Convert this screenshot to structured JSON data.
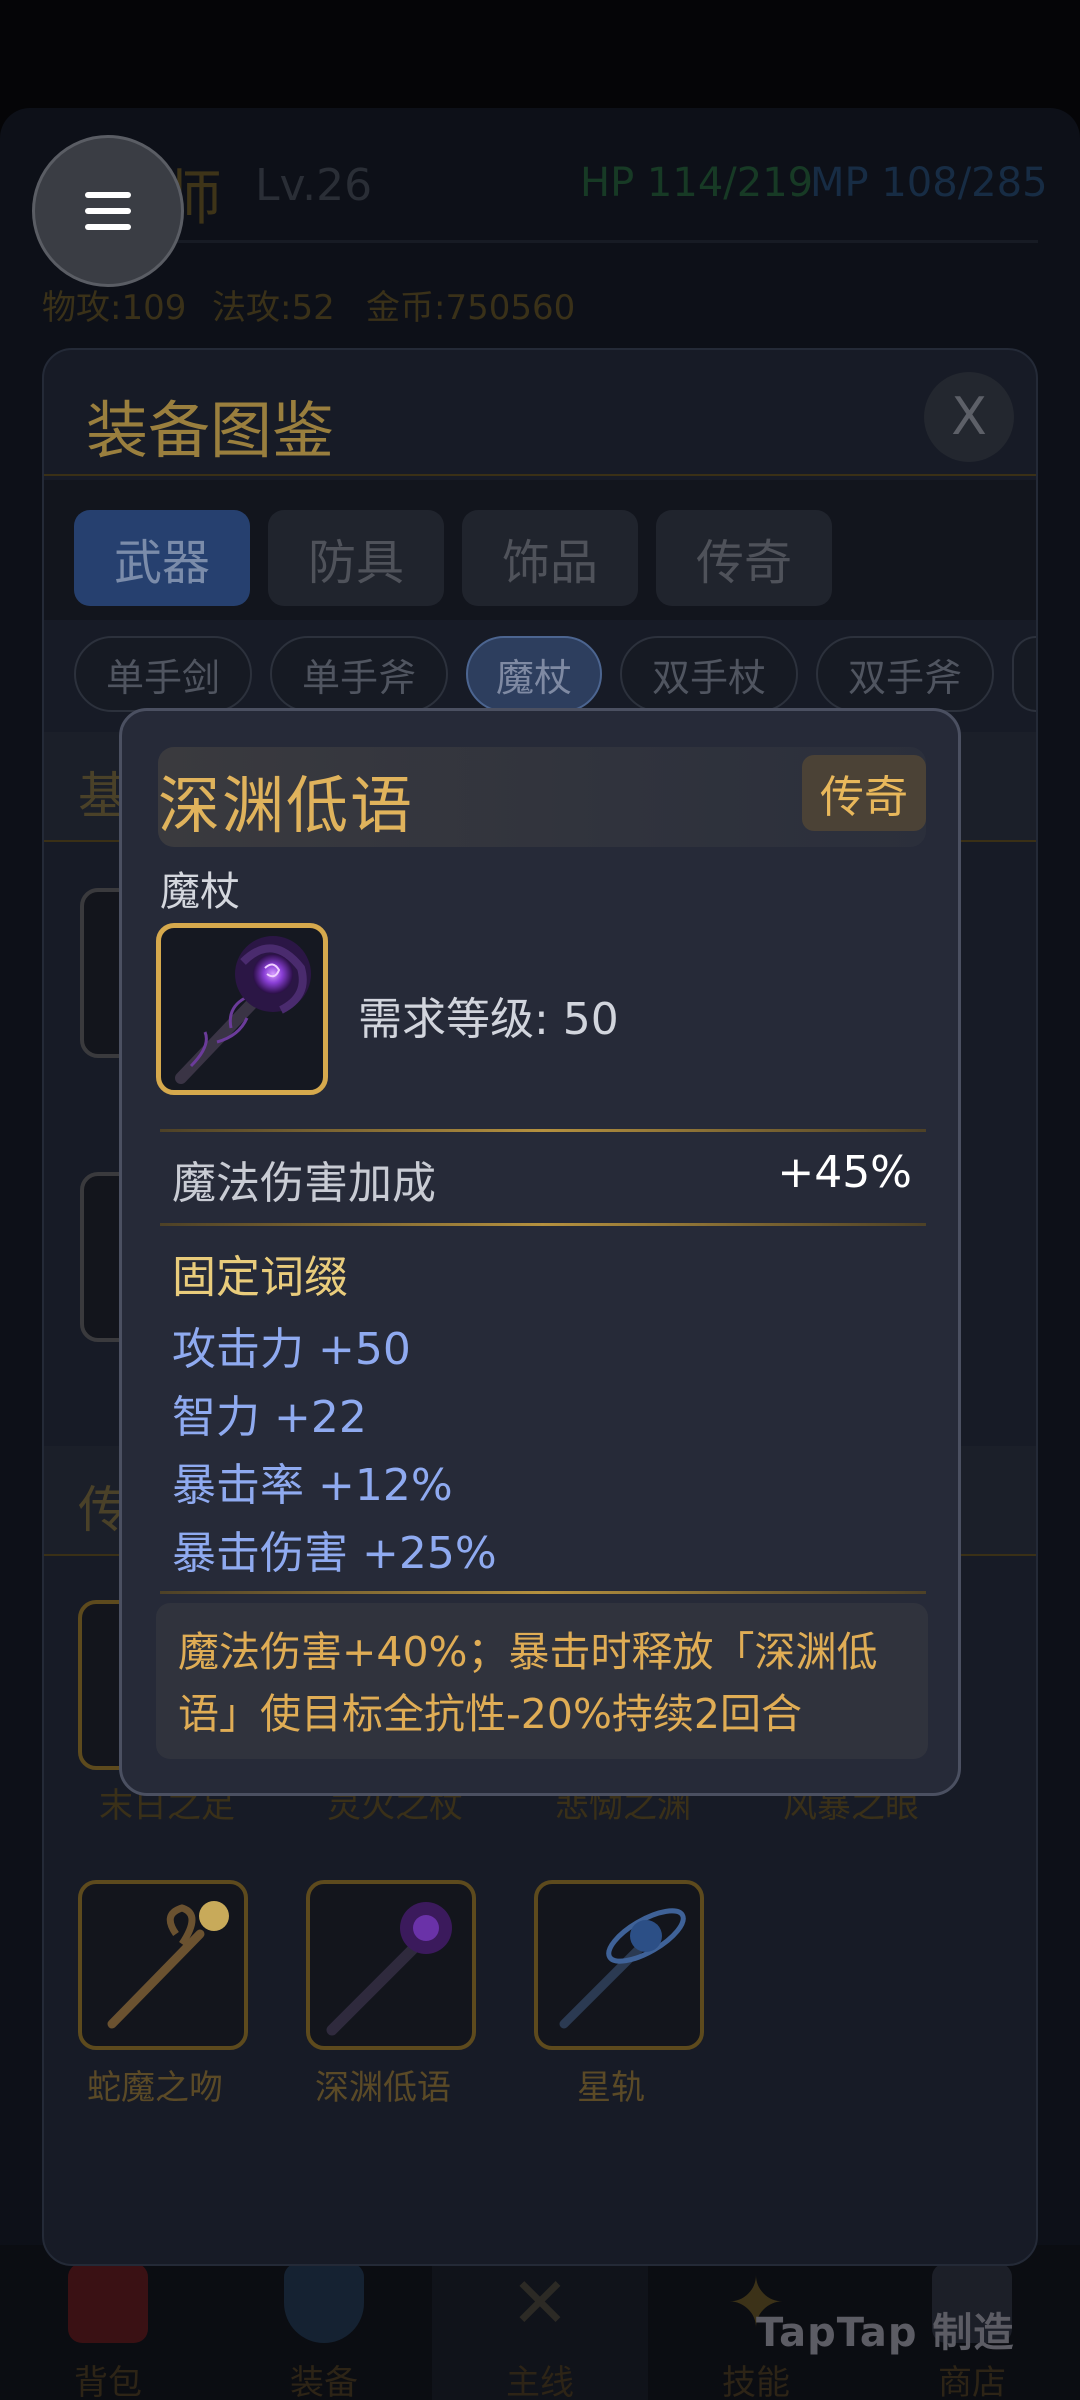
{
  "header": {
    "class_name": "魔法师",
    "level": "Lv.26",
    "hp": "HP 114/219",
    "mp": "MP 108/285",
    "stats": [
      "物攻:109",
      "法攻:52",
      "金币:750560"
    ]
  },
  "menu": {
    "icon": "hamburger-menu-icon"
  },
  "panel": {
    "title": "装备图鉴",
    "close_label": "X",
    "tabs": [
      {
        "label": "武器",
        "active": true
      },
      {
        "label": "防具",
        "active": false
      },
      {
        "label": "饰品",
        "active": false
      },
      {
        "label": "传奇",
        "active": false
      }
    ],
    "subtabs": [
      {
        "label": "单手剑",
        "active": false
      },
      {
        "label": "单手斧",
        "active": false
      },
      {
        "label": "魔杖",
        "active": true
      },
      {
        "label": "双手杖",
        "active": false
      },
      {
        "label": "双手斧",
        "active": false
      }
    ],
    "section_basic": "基",
    "section_legend": "传",
    "legend_row1_labels": [
      "末日之足",
      "灵火之杖",
      "悲恸之渊",
      "风暴之眼"
    ],
    "legend_row2": [
      {
        "name": "蛇魔之吻",
        "icon": "serpent-staff-icon"
      },
      {
        "name": "深渊低语",
        "icon": "abyss-staff-icon"
      },
      {
        "name": "星轨",
        "icon": "star-orbit-staff-icon"
      }
    ]
  },
  "popup": {
    "name": "深渊低语",
    "rarity": "传奇",
    "type": "魔杖",
    "icon": "abyss-staff-icon",
    "requirement": "需求等级: 50",
    "main_attr": {
      "label": "魔法伤害加成",
      "value": "+45%"
    },
    "affix_header": "固定词缀",
    "affixes": [
      "攻击力 +50",
      "智力 +22",
      "暴击率 +12%",
      "暴击伤害 +25%"
    ],
    "description": "魔法伤害+40%；暴击时释放「深渊低语」使目标全抗性-20%持续2回合"
  },
  "bottom_nav": [
    {
      "label": "背包",
      "icon": "backpack-icon"
    },
    {
      "label": "装备",
      "icon": "shield-icon"
    },
    {
      "label": "主线",
      "icon": "crossed-swords-icon"
    },
    {
      "label": "技能",
      "icon": "sparkle-icon"
    },
    {
      "label": "商店",
      "icon": "shop-icon"
    }
  ],
  "watermark": "TapTap 制造",
  "colors": {
    "gold": "#e0b35c",
    "affix_blue": "#8faaf0",
    "tab_active": "#26406f",
    "popup_bg": "#262a38"
  }
}
